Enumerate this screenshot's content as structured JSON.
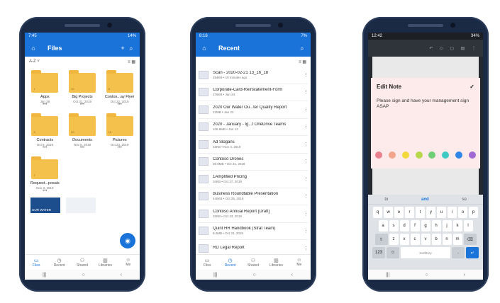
{
  "colors": {
    "accent": "#1a73d8",
    "folder": "#f5c14d",
    "note_bg": "#fdeaea"
  },
  "phone1": {
    "status": {
      "time": "7:45",
      "battery": "14%"
    },
    "title": "Files",
    "sort_label": "A-Z",
    "folders": [
      {
        "count": "1",
        "name": "Apps",
        "date": "Jan 29"
      },
      {
        "count": "10",
        "name": "Big Projects",
        "date": "Oct 31, 2019"
      },
      {
        "count": "8",
        "name": "Contos...ay Flyer",
        "date": "Oct 22, 2019"
      },
      {
        "count": "3",
        "name": "Contracts",
        "date": "Oct 8, 2019"
      },
      {
        "count": "20",
        "name": "Documents",
        "date": "Nov 5, 2019"
      },
      {
        "count": "15",
        "name": "Pictures",
        "date": "Oct 23, 2019"
      },
      {
        "count": "7",
        "name": "Request...posals",
        "date": "Nov 3, 2019"
      }
    ],
    "thumb_label": "OUR WATER",
    "tabs": [
      "Files",
      "Recent",
      "Shared",
      "Libraries",
      "Me"
    ]
  },
  "phone2": {
    "status": {
      "time": "8:16",
      "battery": "7%"
    },
    "title": "Recent",
    "items": [
      {
        "name": "Scan - 2020-02-21 13_16_18",
        "meta": "294KB • 19 minutes ago"
      },
      {
        "name": "Corporate-Card-Reinstatement-Form",
        "meta": "276KB • Jan 24"
      },
      {
        "name": "2020 Our Water Ou...ter Quality Report",
        "meta": "22MB • Jan 23"
      },
      {
        "name": "2020 - January - Ig...t OneDrive Teams",
        "meta": "106.9MB • Jan 13"
      },
      {
        "name": "Ad Slogans",
        "meta": "45KB • Nov 4, 2019"
      },
      {
        "name": "Contoso Drones",
        "meta": "39.9MB • Oct 31, 2019"
      },
      {
        "name": "1Amplified Pricing",
        "meta": "34KB • Oct 27, 2019"
      },
      {
        "name": "Business Roundtable Presentation",
        "meta": "445KB • Oct 25, 2019"
      },
      {
        "name": "Contoso Annual Report [Draft]",
        "meta": "32KB • Oct 23, 2019"
      },
      {
        "name": "Quint HR Handbook (Strat Team)",
        "meta": "9.2MB • Oct 22, 2019"
      },
      {
        "name": "RD Legal Report",
        "meta": ""
      }
    ],
    "tabs": [
      "Files",
      "Recent",
      "Shared",
      "Libraries",
      "Me"
    ]
  },
  "phone3": {
    "status": {
      "time": "12:42",
      "battery": "34%"
    },
    "note_title": "Edit Note",
    "note_body": "Please sign and have your management sign ASAP",
    "swatch_colors": [
      "#ea7f8e",
      "#f2a58a",
      "#f4d93c",
      "#b7d84b",
      "#6fcf74",
      "#3fc9c4",
      "#2f86e6",
      "#a06ad2"
    ],
    "suggestions": [
      "to",
      "and",
      "so"
    ],
    "keys_row1": [
      "q",
      "w",
      "e",
      "r",
      "t",
      "y",
      "u",
      "i",
      "o",
      "p"
    ],
    "keys_row2": [
      "a",
      "s",
      "d",
      "f",
      "g",
      "h",
      "j",
      "k",
      "l"
    ],
    "keys_row3": [
      "z",
      "x",
      "c",
      "v",
      "b",
      "n",
      "m"
    ],
    "kb_num": "123",
    "kb_space": "SwiftKey"
  }
}
